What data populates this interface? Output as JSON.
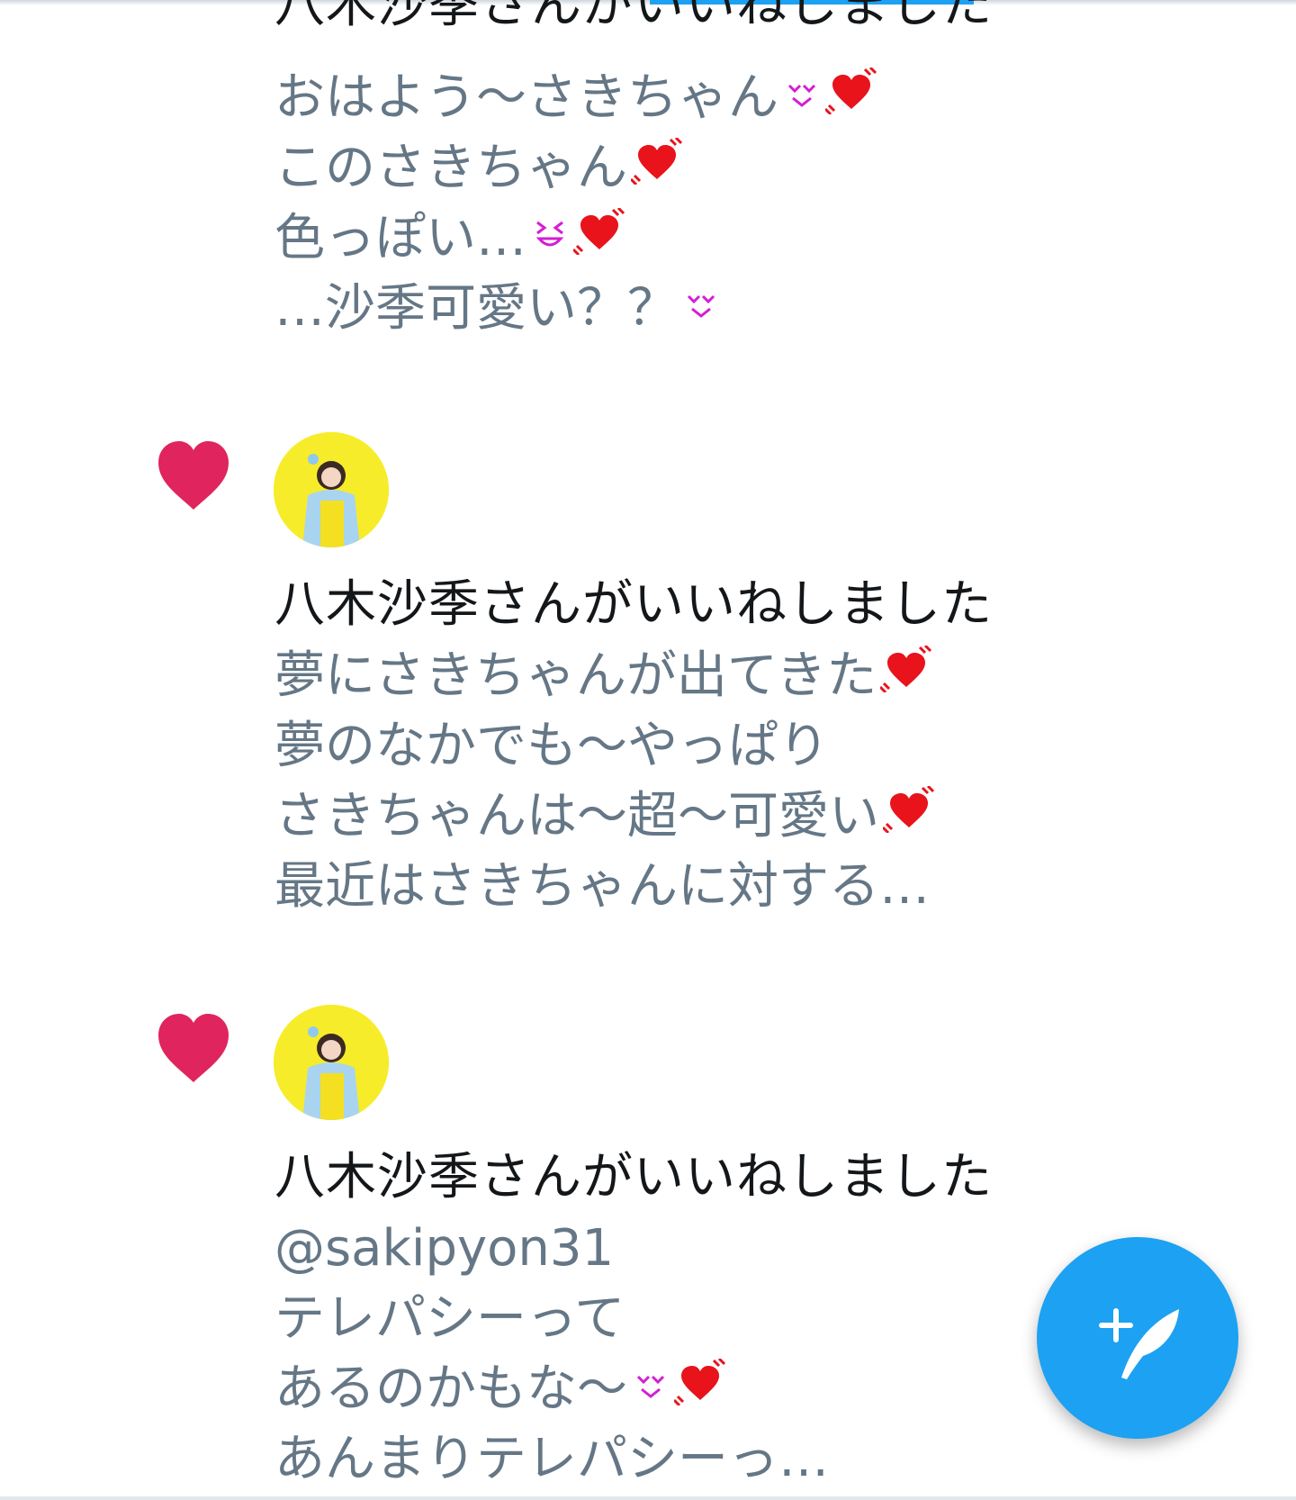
{
  "notifications": [
    {
      "liked_by_text": "八木沙季さんがいいねしました",
      "tweet_lines": [
        "おはよう〜さきちゃん",
        "このさきちゃん",
        "色っぽい…",
        "…沙季可愛い？？"
      ]
    },
    {
      "liked_by_text": "八木沙季さんがいいねしました",
      "tweet_lines": [
        "夢にさきちゃんが出てきた",
        "夢のなかでも〜やっぱり",
        "さきちゃんは〜超〜可愛い",
        "最近はさきちゃんに対する…"
      ]
    },
    {
      "liked_by_text": "八木沙季さんがいいねしました",
      "tweet_lines": [
        "@sakipyon31",
        "テレパシーって",
        "あるのかもな〜",
        "あんまりテレパシーっ…"
      ]
    }
  ],
  "icons": {
    "like": "heart-icon",
    "compose": "compose-tweet-icon",
    "emoji_heart": "revolving-heart-emoji",
    "emoji_smile": "smile-emoji",
    "emoji_grin": "grin-squint-emoji"
  },
  "colors": {
    "like_heart": "#e0245e",
    "accent": "#1da1f2",
    "tweet_text": "#657786",
    "primary_text": "#14171a",
    "avatar_bg": "#f7ec2a"
  }
}
